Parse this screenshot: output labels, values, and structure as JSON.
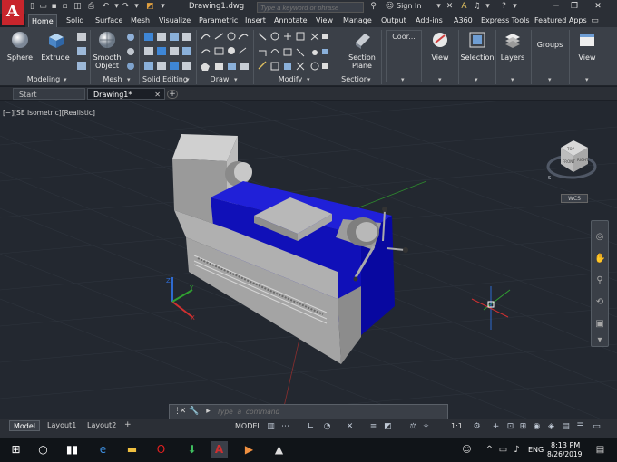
{
  "app": {
    "logo_letter": "A",
    "document_title": "Drawing1.dwg",
    "search_placeholder": "Type a keyword or phrase",
    "sign_in": "Sign In"
  },
  "ribbon_tabs": [
    "Home",
    "Solid",
    "Surface",
    "Mesh",
    "Visualize",
    "Parametric",
    "Insert",
    "Annotate",
    "View",
    "Manage",
    "Output",
    "Add-ins",
    "A360",
    "Express Tools",
    "Featured Apps"
  ],
  "active_ribbon_tab": "Home",
  "ribbon": {
    "sphere": "Sphere",
    "extrude": "Extrude",
    "smooth_object_1": "Smooth",
    "smooth_object_2": "Object",
    "section_plane_1": "Section",
    "section_plane_2": "Plane",
    "coor": "Coor...",
    "view_button": "View",
    "selection": "Selection",
    "layers": "Layers",
    "groups": "Groups",
    "view_button_2": "View",
    "panels": {
      "modeling": "Modeling",
      "mesh": "Mesh",
      "solid_editing": "Solid Editing",
      "draw": "Draw",
      "modify": "Modify",
      "section": "Section"
    }
  },
  "doc_tabs": [
    "Start",
    "Drawing1*"
  ],
  "viewport": {
    "label": "[−][SE Isometric][Realistic]",
    "wcs": "WCS"
  },
  "command_line": {
    "placeholder": "Type  a  command"
  },
  "layout_tabs": [
    "Model",
    "Layout1",
    "Layout2"
  ],
  "status": {
    "model": "MODEL",
    "scale": "1:1"
  },
  "taskbar": {
    "language": "ENG",
    "time": "8:13 PM",
    "date": "8/26/2019"
  },
  "colors": {
    "autocad_red": "#c8252c",
    "viewport_bg": "#232830",
    "lathe_blue": "#1414c8",
    "lathe_gray": "#a9a9a9"
  }
}
